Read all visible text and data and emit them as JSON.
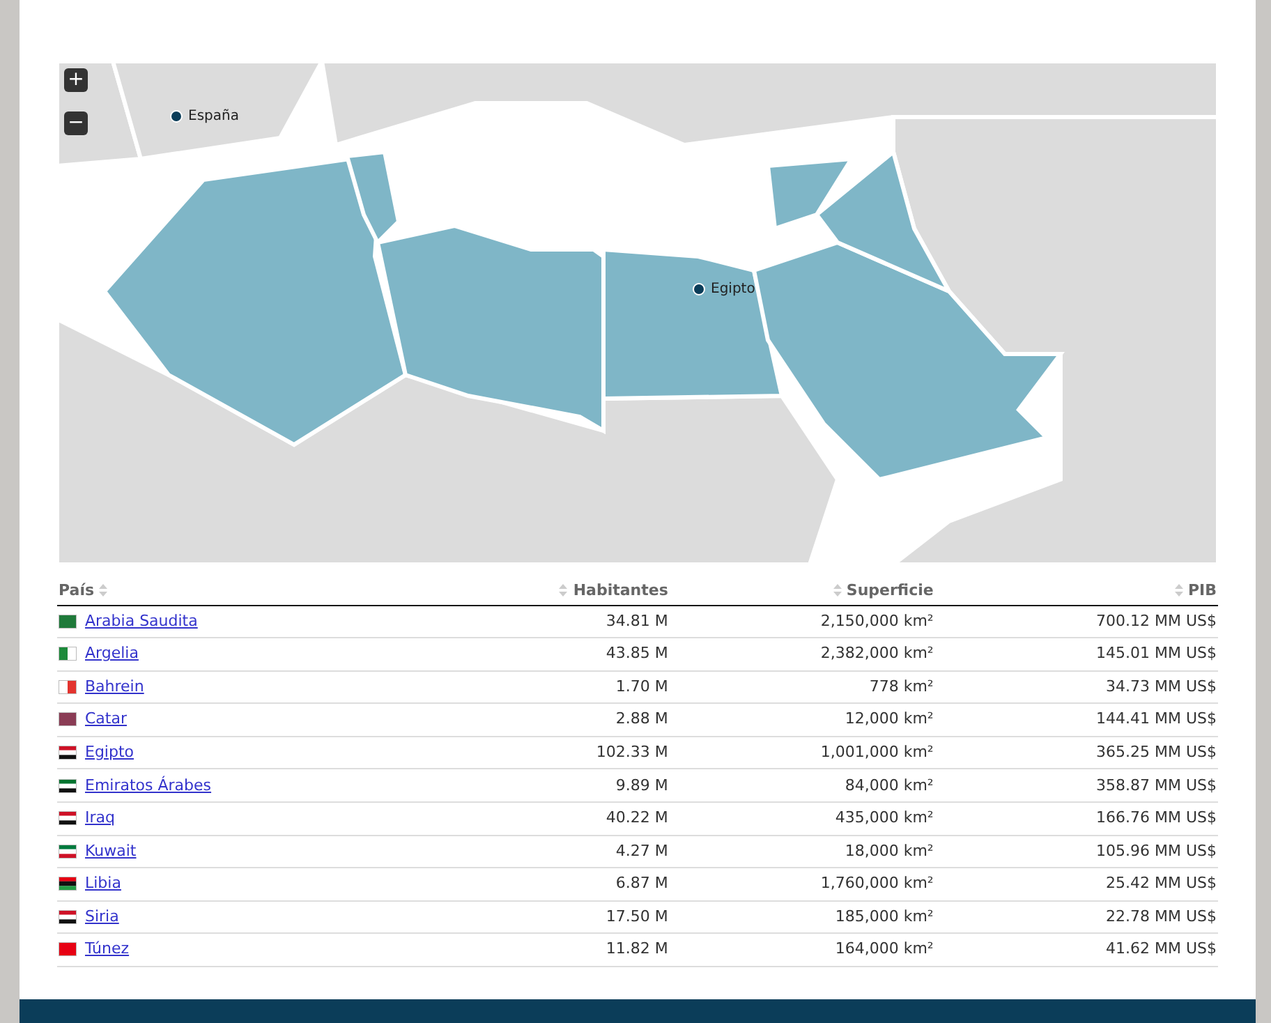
{
  "map": {
    "zoom_controls": [
      "+",
      "−"
    ],
    "markers": [
      {
        "label": "España"
      },
      {
        "label": "Egipto"
      }
    ]
  },
  "table": {
    "columns": [
      "País",
      "Habitantes",
      "Superficie",
      "PIB"
    ],
    "rows": [
      {
        "country": "Arabia Saudita",
        "population": "34.81 M",
        "area": "2,150,000 km²",
        "gdp": "700.12 MM US$"
      },
      {
        "country": "Argelia",
        "population": "43.85 M",
        "area": "2,382,000 km²",
        "gdp": "145.01 MM US$"
      },
      {
        "country": "Bahrein",
        "population": "1.70 M",
        "area": "778 km²",
        "gdp": "34.73 MM US$"
      },
      {
        "country": "Catar",
        "population": "2.88 M",
        "area": "12,000 km²",
        "gdp": "144.41 MM US$"
      },
      {
        "country": "Egipto",
        "population": "102.33 M",
        "area": "1,001,000 km²",
        "gdp": "365.25 MM US$"
      },
      {
        "country": "Emiratos Árabes",
        "population": "9.89 M",
        "area": "84,000 km²",
        "gdp": "358.87 MM US$"
      },
      {
        "country": "Iraq",
        "population": "40.22 M",
        "area": "435,000 km²",
        "gdp": "166.76 MM US$"
      },
      {
        "country": "Kuwait",
        "population": "4.27 M",
        "area": "18,000 km²",
        "gdp": "105.96 MM US$"
      },
      {
        "country": "Libia",
        "population": "6.87 M",
        "area": "1,760,000 km²",
        "gdp": "25.42 MM US$"
      },
      {
        "country": "Siria",
        "population": "17.50 M",
        "area": "185,000 km²",
        "gdp": "22.78 MM US$"
      },
      {
        "country": "Túnez",
        "population": "11.82 M",
        "area": "164,000 km²",
        "gdp": "41.62 MM US$"
      }
    ]
  }
}
